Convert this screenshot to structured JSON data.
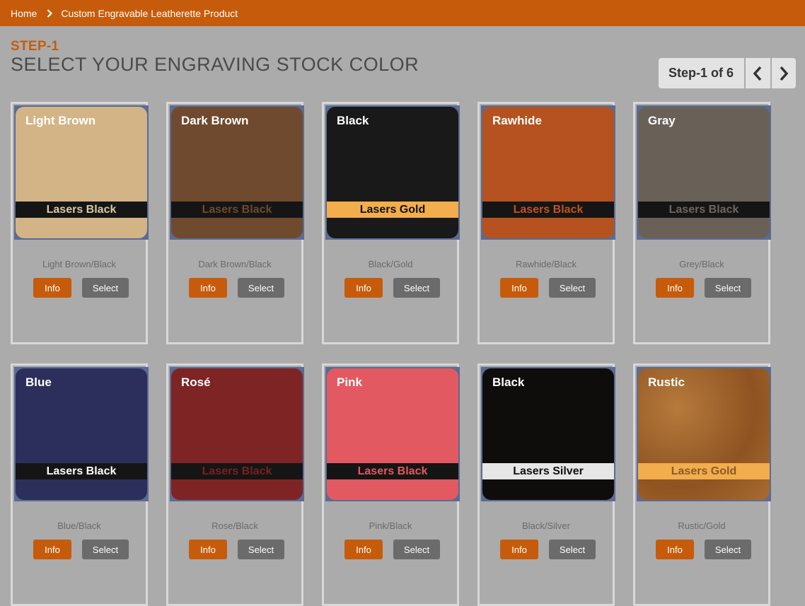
{
  "breadcrumb": {
    "home": "Home",
    "current": "Custom Engravable Leatherette Product"
  },
  "step": {
    "label": "STEP-1",
    "title": "SELECT YOUR ENGRAVING STOCK COLOR",
    "nav_text": "Step-1 of 6"
  },
  "colors": {
    "accent": "#c65c0b",
    "select_button": "#6b6b6b",
    "background": "#ababab"
  },
  "buttons": {
    "info": "Info",
    "select": "Select"
  },
  "products": [
    {
      "name": "Light Brown",
      "band": "Lasers Black",
      "caption": "Light Brown/Black",
      "band_text_color": "#d8c9a6"
    },
    {
      "name": "Dark Brown",
      "band": "Lasers Black",
      "caption": "Dark Brown/Black",
      "band_text_color": "#6e4a2e"
    },
    {
      "name": "Black",
      "band": "Lasers Gold",
      "caption": "Black/Gold",
      "band_text_color": "#111111"
    },
    {
      "name": "Rawhide",
      "band": "Lasers Black",
      "caption": "Rawhide/Black",
      "band_text_color": "#c0541f"
    },
    {
      "name": "Gray",
      "band": "Lasers Black",
      "caption": "Grey/Black",
      "band_text_color": "#6f665e"
    },
    {
      "name": "Blue",
      "band": "Lasers Black",
      "caption": "Blue/Black",
      "band_text_color": "#ffffff"
    },
    {
      "name": "Rosé",
      "band": "Lasers Black",
      "caption": "Rose/Black",
      "band_text_color": "#7a2020"
    },
    {
      "name": "Pink",
      "band": "Lasers Black",
      "caption": "Pink/Black",
      "band_text_color": "#e35961"
    },
    {
      "name": "Black",
      "band": "Lasers Silver",
      "caption": "Black/Silver",
      "band_text_color": "#111111"
    },
    {
      "name": "Rustic",
      "band": "Lasers Gold",
      "caption": "Rustic/Gold",
      "band_text_color": "#8a5a2a"
    }
  ]
}
